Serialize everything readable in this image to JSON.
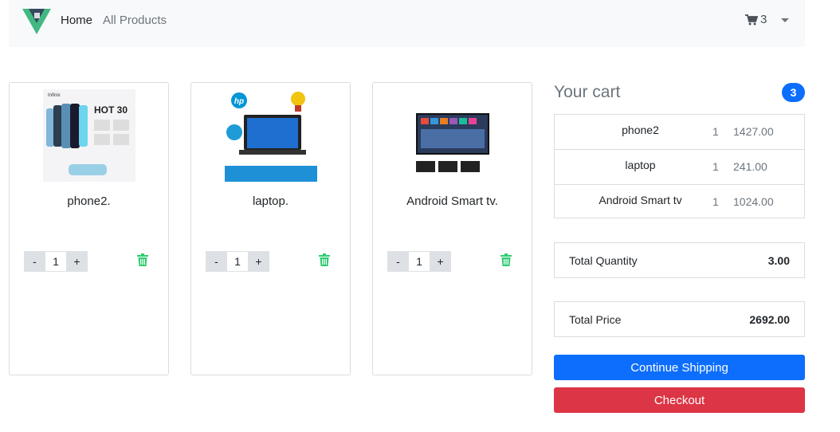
{
  "nav": {
    "home_label": "Home",
    "products_label": "All Products",
    "cart_count": "3"
  },
  "products": [
    {
      "name": "phone2.",
      "quantity": "1",
      "image_brand": "Infinix",
      "image_model": "HOT 30"
    },
    {
      "name": "laptop.",
      "quantity": "1",
      "image_brand": "hp"
    },
    {
      "name": "Android Smart tv.",
      "quantity": "1"
    }
  ],
  "qty_controls": {
    "minus": "-",
    "plus": "+"
  },
  "cart": {
    "title": "Your cart",
    "badge": "3",
    "items": [
      {
        "name": "phone2",
        "qty": "1",
        "price": "1427.00"
      },
      {
        "name": "laptop",
        "qty": "1",
        "price": "241.00"
      },
      {
        "name": "Android Smart tv",
        "qty": "1",
        "price": "1024.00"
      }
    ],
    "total_quantity_label": "Total Quantity",
    "total_quantity": "3.00",
    "total_price_label": "Total Price",
    "total_price": "2692.00",
    "continue_label": "Continue Shipping",
    "checkout_label": "Checkout"
  },
  "colors": {
    "primary": "#0d6efd",
    "danger": "#dc3545",
    "trash": "#2ecc71",
    "logo_green": "#42b883",
    "logo_dark": "#35495e"
  }
}
